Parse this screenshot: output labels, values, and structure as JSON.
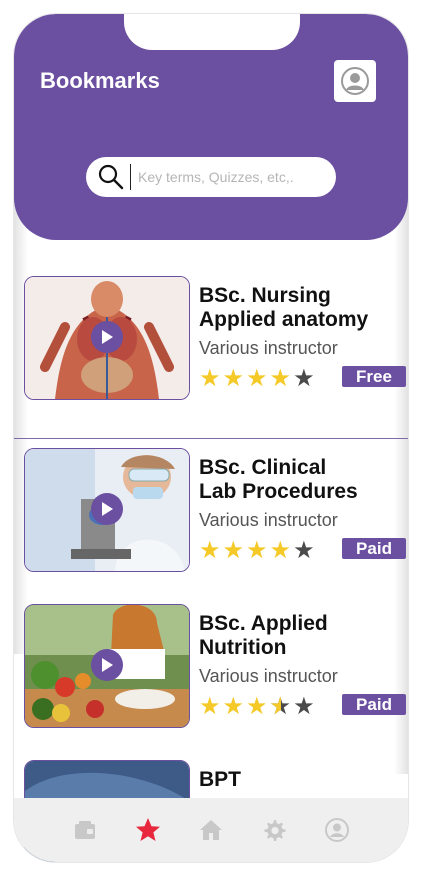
{
  "header": {
    "title": "Bookmarks",
    "search_placeholder": "Key terms, Quizzes, etc,."
  },
  "courses": [
    {
      "title_line1": "BSc. Nursing",
      "title_line2": "Applied anatomy",
      "instructor": "Various instructor",
      "rating": 4,
      "badge": "Free"
    },
    {
      "title_line1": "BSc. Clinical",
      "title_line2": "Lab Procedures",
      "instructor": "Various instructor",
      "rating": 4,
      "badge": "Paid"
    },
    {
      "title_line1": "BSc. Applied",
      "title_line2": "Nutrition",
      "instructor": "Various instructor",
      "rating": 3.5,
      "badge": "Paid"
    },
    {
      "title_line1": "BPT",
      "title_line2": "",
      "instructor": "",
      "rating": null,
      "badge": ""
    }
  ],
  "bottom_nav": [
    {
      "icon": "wallet-icon",
      "active": false
    },
    {
      "icon": "star-icon",
      "active": true
    },
    {
      "icon": "home-icon",
      "active": false
    },
    {
      "icon": "gear-icon",
      "active": false
    },
    {
      "icon": "user-icon",
      "active": false
    }
  ],
  "colors": {
    "brand": "#6b4fa0",
    "star": "#f5c928",
    "active_nav": "#e8283c",
    "inactive_nav": "#c8c8c8"
  }
}
